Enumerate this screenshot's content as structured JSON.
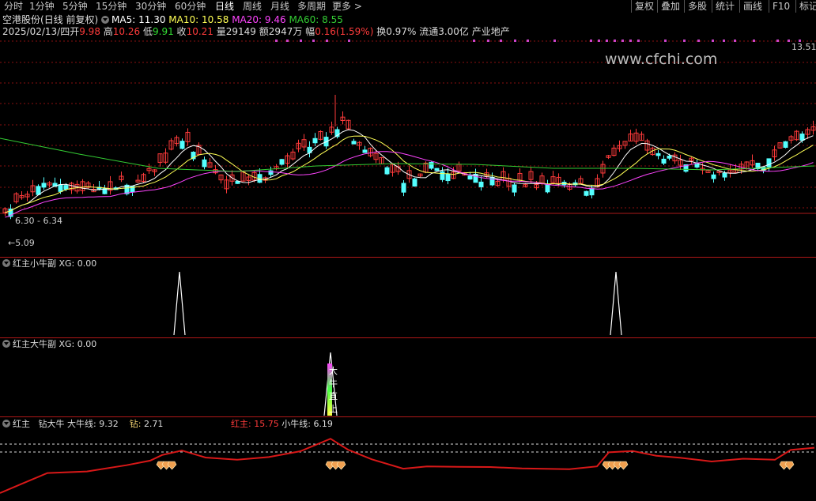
{
  "toolbar": {
    "periods": [
      "分时",
      "1分钟",
      "5分钟",
      "15分钟",
      "30分钟",
      "60分钟",
      "日线",
      "周线",
      "月线",
      "多周期",
      "更多"
    ],
    "active_period": "日线",
    "right_buttons": [
      "复权",
      "叠加",
      "多股",
      "统计",
      "画线",
      "F10",
      "标记"
    ]
  },
  "stock": {
    "name": "空港股份",
    "mode": "(日线 前复权)",
    "ma5_label": "MA5:",
    "ma5": "11.30",
    "ma10_label": "MA10:",
    "ma10": "10.58",
    "ma20_label": "MA20:",
    "ma20": "9.46",
    "ma60_label": "MA60:",
    "ma60": "8.55"
  },
  "quote": {
    "date": "2025/02/13/四",
    "open_label": "开",
    "open": "9.98",
    "high_label": "高",
    "high": "10.26",
    "low_label": "低",
    "low": "9.91",
    "close_label": "收",
    "close": "10.21",
    "vol_label": "量",
    "vol": "29149",
    "amount_label": "额",
    "amount": "2947万",
    "change_label": "幅",
    "change": "0.16(1.59%)",
    "turnover_label": "换",
    "turnover": "0.97%",
    "float_label": "流通",
    "float": "3.00亿",
    "sector": "产业地产"
  },
  "watermark": "www.cfchi.com",
  "main_chart": {
    "price_high_label": "13.51",
    "range_label": "6.30 - 6.34",
    "low_label": "5.09"
  },
  "panel1": {
    "title": "红主小牛副",
    "xg_label": "XG:",
    "xg": "0.00"
  },
  "panel2": {
    "title": "红主大牛副",
    "xg_label": "XG:",
    "xg": "0.00",
    "marker": [
      "大",
      "牛",
      "直",
      "上"
    ]
  },
  "panel3": {
    "title": "红主",
    "diamond_label": "钻大牛",
    "bull_label": "大牛线:",
    "bull": "9.32",
    "zuan_label": "钻:",
    "zuan": "2.71",
    "red_label": "红主:",
    "red": "15.75",
    "small_bull_label": "小牛线:",
    "small_bull": "6.19"
  },
  "colors": {
    "up": "#ff3b3b",
    "down": "#54ffff",
    "ma5": "#ffffff",
    "ma10": "#ffff55",
    "ma20": "#ff44ff",
    "ma60": "#33cc33",
    "separator": "#b01818",
    "red_line": "#d81818",
    "diamond": "#f0a050"
  },
  "chart_data": {
    "type": "candlestick",
    "price_axis_max": 13.51,
    "price_axis_min": 5.09,
    "current_close": 10.21
  }
}
